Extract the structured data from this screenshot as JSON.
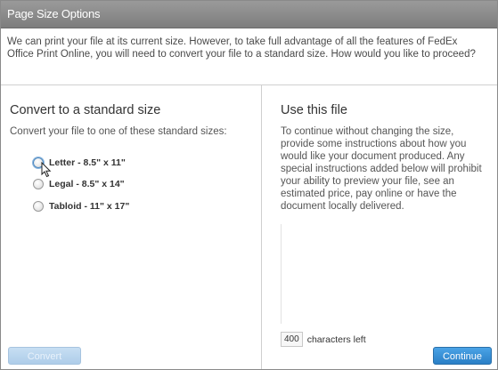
{
  "dialog": {
    "title": "Page Size Options",
    "intro": "We can print your file at its current size.  However, to take full advantage of all the features of FedEx Office Print Online, you will need to convert your file to a standard size.  How would you like to proceed?"
  },
  "left": {
    "heading": "Convert to a standard size",
    "subtext": "Convert your file to one of these standard sizes:",
    "options": [
      {
        "label": "Letter - 8.5\" x 11\""
      },
      {
        "label": "Legal - 8.5\" x 14\""
      },
      {
        "label": "Tabloid - 11\" x 17\""
      }
    ],
    "convert_button": "Convert"
  },
  "right": {
    "heading": "Use this file",
    "description": "To continue without changing the size, provide some instructions about how you would like your document produced. Any special instructions added below will prohibit your ability to preview your file, see an estimated price, pay online or have the document locally delivered.",
    "instructions_value": "",
    "chars_left": "400",
    "chars_left_label": "characters left",
    "continue_button": "Continue"
  },
  "colors": {
    "titlebar": "#8a8a8a",
    "continue": "#2a7fc6",
    "convert_disabled": "#aecde9"
  }
}
